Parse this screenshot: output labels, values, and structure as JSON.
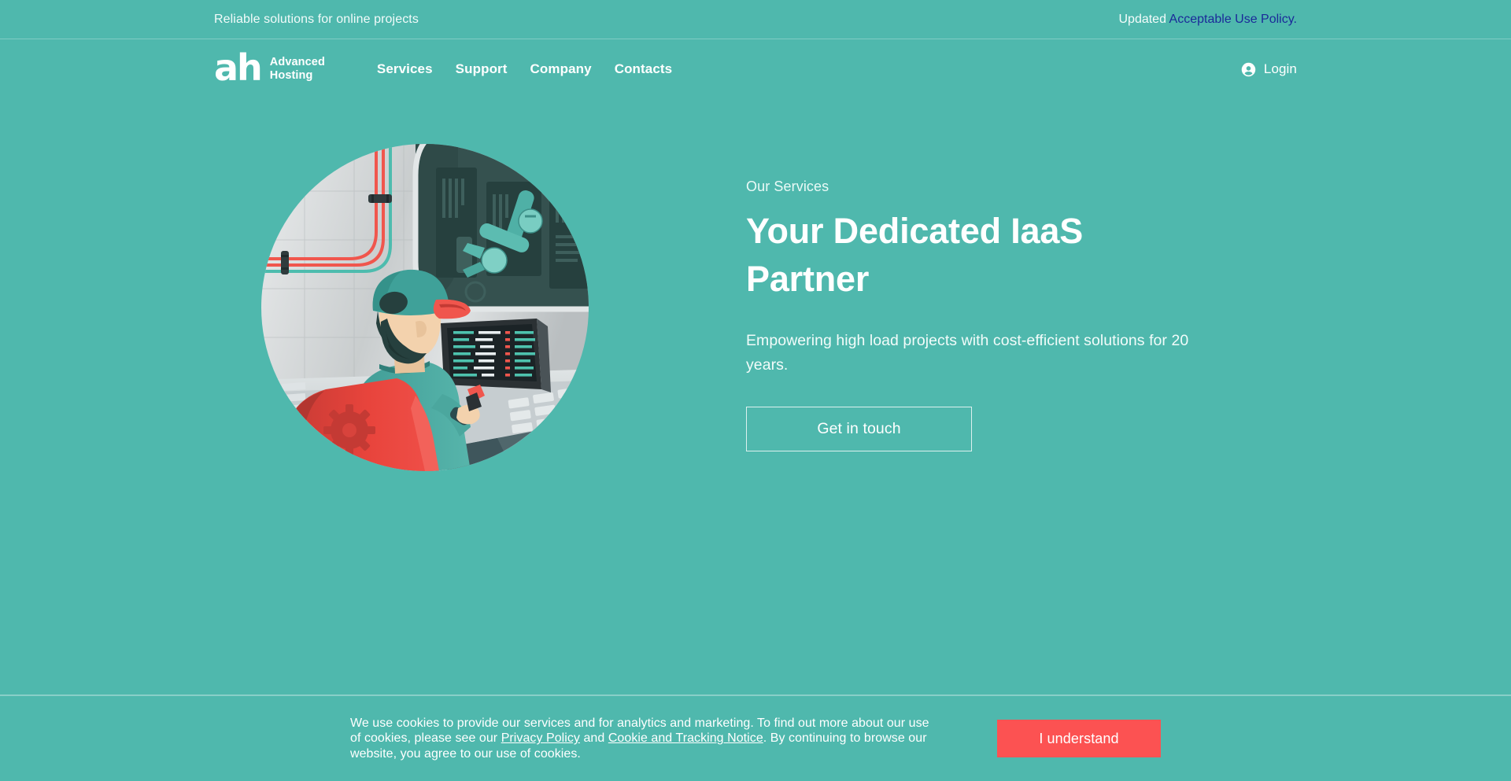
{
  "theme": {
    "background": "#4fb8ad",
    "accent_red": "#fc5252",
    "link_blue": "#1b2a99",
    "text_white": "#ffffff"
  },
  "topbar": {
    "tagline": "Reliable solutions for online projects",
    "updated_label": "Updated",
    "policy_link": "Acceptable Use Policy",
    "policy_period": "."
  },
  "header": {
    "brand": {
      "mark": "ah",
      "line1": "Advanced",
      "line2": "Hosting"
    },
    "nav": [
      {
        "label": "Services"
      },
      {
        "label": "Support"
      },
      {
        "label": "Company"
      },
      {
        "label": "Contacts"
      }
    ],
    "login_label": "Login",
    "login_icon": "account-circle-icon"
  },
  "hero": {
    "eyebrow": "Our Services",
    "headline": "Your Dedicated IaaS Partner",
    "subhead": "Empowering high load projects with cost-efficient solutions for 20 years.",
    "cta_label": "Get in touch",
    "illustration": {
      "name": "engineer-at-console-illustration",
      "description": "Circular illustration of an engineer in a teal cap and jacket seated in a red chair, facing a dark monitor with code, a keyboard, a robotic arm and colored pipes in a server room"
    }
  },
  "cookie_banner": {
    "text_part1": "We use cookies to provide our services and for analytics and marketing. To find out more about our use of cookies, please see our ",
    "link1": "Privacy Policy",
    "text_part2": " and ",
    "link2": "Cookie and Tracking Notice",
    "text_part3": ". By continuing to browse our website, you agree to our use of cookies.",
    "accept_label": "I understand"
  }
}
